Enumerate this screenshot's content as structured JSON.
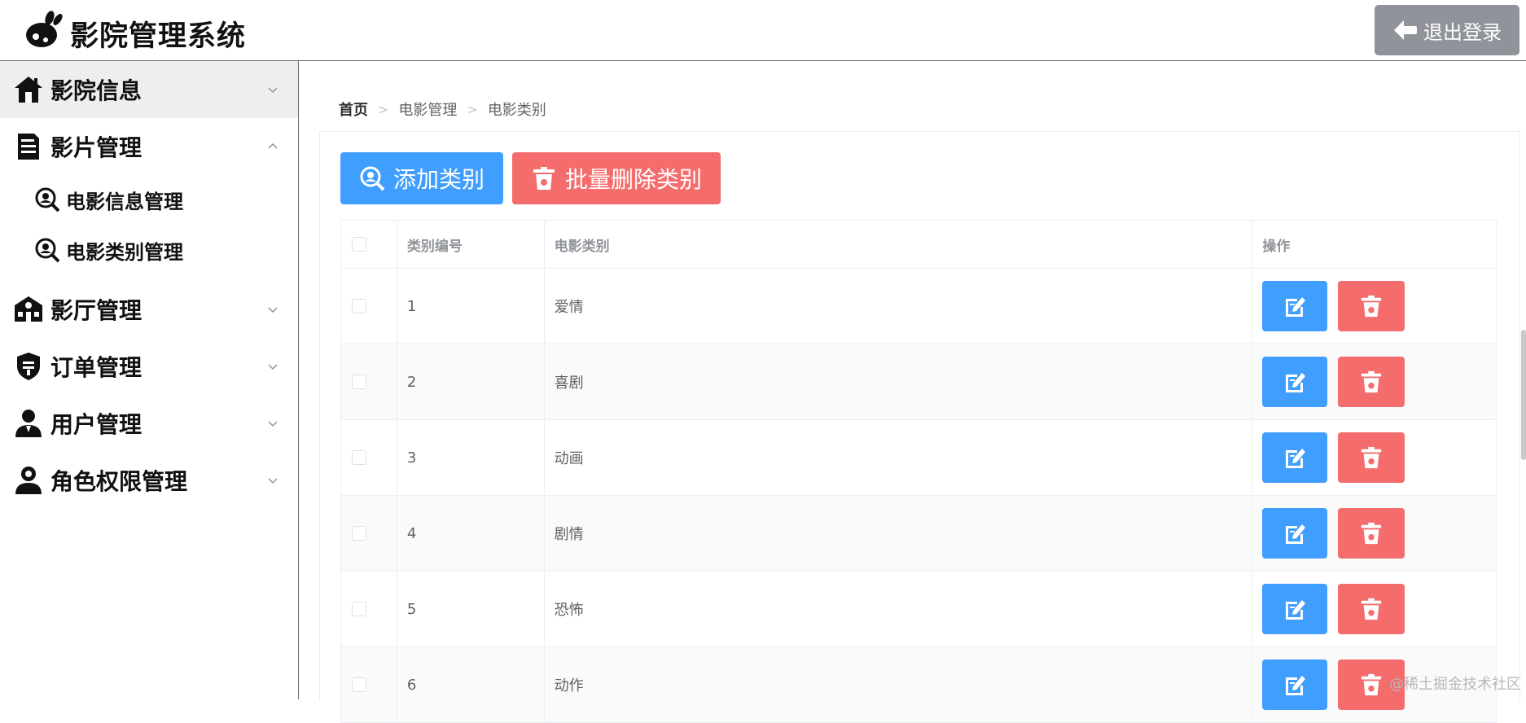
{
  "header": {
    "title": "影院管理系统",
    "logout_label": "退出登录"
  },
  "sidebar": {
    "items": [
      {
        "label": "影院信息",
        "icon": "home-icon",
        "expanded": false,
        "active": true
      },
      {
        "label": "影片管理",
        "icon": "document-icon",
        "expanded": true,
        "children": [
          {
            "label": "电影信息管理",
            "icon": "search-icon"
          },
          {
            "label": "电影类别管理",
            "icon": "search-icon"
          }
        ]
      },
      {
        "label": "影厅管理",
        "icon": "building-icon",
        "expanded": false
      },
      {
        "label": "订单管理",
        "icon": "shield-icon",
        "expanded": false
      },
      {
        "label": "用户管理",
        "icon": "user-icon",
        "expanded": false
      },
      {
        "label": "角色权限管理",
        "icon": "user-role-icon",
        "expanded": false
      }
    ]
  },
  "breadcrumb": [
    "首页",
    "电影管理",
    "电影类别"
  ],
  "toolbar": {
    "add_label": "添加类别",
    "batch_delete_label": "批量删除类别"
  },
  "table": {
    "columns": [
      "类别编号",
      "电影类别",
      "操作"
    ],
    "rows": [
      {
        "id": "1",
        "type": "爱情"
      },
      {
        "id": "2",
        "type": "喜剧"
      },
      {
        "id": "3",
        "type": "动画"
      },
      {
        "id": "4",
        "type": "剧情"
      },
      {
        "id": "5",
        "type": "恐怖"
      },
      {
        "id": "6",
        "type": "动作"
      }
    ]
  },
  "watermark": "@稀土掘金技术社区",
  "colors": {
    "primary": "#409eff",
    "danger": "#f56c6c",
    "info": "#909399",
    "active_bg": "#eeeeee"
  }
}
